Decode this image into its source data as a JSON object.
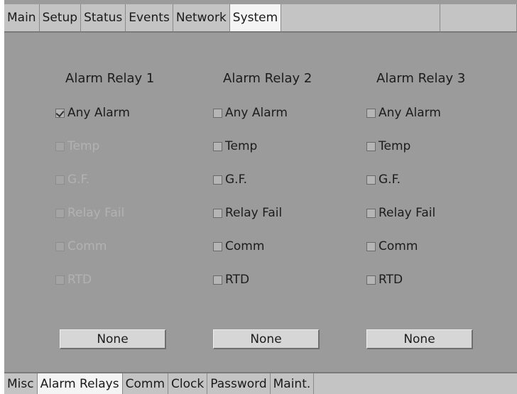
{
  "top_tabs": [
    "Main",
    "Setup",
    "Status",
    "Events",
    "Network",
    "System"
  ],
  "active_top_tab": "System",
  "bottom_tabs": [
    "Misc",
    "Alarm Relays",
    "Comm",
    "Clock",
    "Password",
    "Maint."
  ],
  "active_bottom_tab": "Alarm Relays",
  "relays": [
    {
      "title": "Alarm Relay 1",
      "options": [
        {
          "label": "Any Alarm",
          "checked": true,
          "enabled": true
        },
        {
          "label": "Temp",
          "checked": false,
          "enabled": false
        },
        {
          "label": "G.F.",
          "checked": false,
          "enabled": false
        },
        {
          "label": "Relay Fail",
          "checked": false,
          "enabled": false
        },
        {
          "label": "Comm",
          "checked": false,
          "enabled": false
        },
        {
          "label": "RTD",
          "checked": false,
          "enabled": false
        }
      ],
      "button_label": "None"
    },
    {
      "title": "Alarm Relay 2",
      "options": [
        {
          "label": "Any Alarm",
          "checked": false,
          "enabled": true
        },
        {
          "label": "Temp",
          "checked": false,
          "enabled": true
        },
        {
          "label": "G.F.",
          "checked": false,
          "enabled": true
        },
        {
          "label": "Relay Fail",
          "checked": false,
          "enabled": true
        },
        {
          "label": "Comm",
          "checked": false,
          "enabled": true
        },
        {
          "label": "RTD",
          "checked": false,
          "enabled": true
        }
      ],
      "button_label": "None"
    },
    {
      "title": "Alarm Relay 3",
      "options": [
        {
          "label": "Any Alarm",
          "checked": false,
          "enabled": true
        },
        {
          "label": "Temp",
          "checked": false,
          "enabled": true
        },
        {
          "label": "G.F.",
          "checked": false,
          "enabled": true
        },
        {
          "label": "Relay Fail",
          "checked": false,
          "enabled": true
        },
        {
          "label": "Comm",
          "checked": false,
          "enabled": true
        },
        {
          "label": "RTD",
          "checked": false,
          "enabled": true
        }
      ],
      "button_label": "None"
    }
  ]
}
